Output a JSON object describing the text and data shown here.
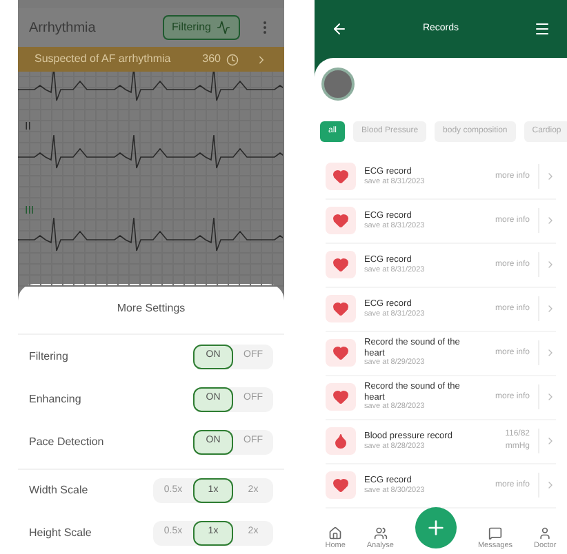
{
  "ecg_screen": {
    "title": "Arrhythmia",
    "filter_button": "Filtering",
    "alert": {
      "text": "Suspected of AF arrhythmia",
      "value": "360"
    },
    "leads": [
      "II",
      "III"
    ]
  },
  "settings_sheet": {
    "title": "More Settings",
    "rows": [
      {
        "label": "Filtering",
        "options": [
          {
            "label": "ON",
            "selected": true
          },
          {
            "label": "OFF",
            "selected": false
          }
        ]
      },
      {
        "label": "Enhancing",
        "options": [
          {
            "label": "ON",
            "selected": true
          },
          {
            "label": "OFF",
            "selected": false
          }
        ]
      },
      {
        "label": "Pace Detection",
        "options": [
          {
            "label": "ON",
            "selected": true
          },
          {
            "label": "OFF",
            "selected": false
          }
        ]
      },
      {
        "label": "Width Scale",
        "options": [
          {
            "label": "0.5x",
            "selected": false
          },
          {
            "label": "1x",
            "selected": true
          },
          {
            "label": "2x",
            "selected": false
          }
        ]
      },
      {
        "label": "Height Scale",
        "options": [
          {
            "label": "0.5x",
            "selected": false
          },
          {
            "label": "1x",
            "selected": true
          },
          {
            "label": "2x",
            "selected": false
          }
        ]
      }
    ]
  },
  "records_screen": {
    "title": "Records",
    "chips": [
      {
        "label": "all",
        "selected": true
      },
      {
        "label": "Blood Pressure",
        "selected": false
      },
      {
        "label": "body composition",
        "selected": false
      },
      {
        "label": "Cardiop",
        "selected": false
      }
    ],
    "records": [
      {
        "kind": "ecg",
        "title": "ECG record",
        "subtitle": "save at 8/31/2023",
        "detail": "more info"
      },
      {
        "kind": "ecg",
        "title": "ECG record",
        "subtitle": "save at 8/31/2023",
        "detail": "more info"
      },
      {
        "kind": "ecg",
        "title": "ECG record",
        "subtitle": "save at 8/31/2023",
        "detail": "more info"
      },
      {
        "kind": "ecg",
        "title": "ECG record",
        "subtitle": "save at 8/31/2023",
        "detail": "more info"
      },
      {
        "kind": "sound",
        "title": "Record the sound of the heart",
        "subtitle": "save at 8/29/2023",
        "detail": "more info"
      },
      {
        "kind": "sound",
        "title": "Record the sound of the heart",
        "subtitle": "save at 8/28/2023",
        "detail": "more info"
      },
      {
        "kind": "bp",
        "title": "Blood pressure record",
        "subtitle": "save at 8/28/2023",
        "detail": "116/82 mmHg"
      },
      {
        "kind": "ecg",
        "title": "ECG record",
        "subtitle": "save at 8/30/2023",
        "detail": "more info"
      }
    ],
    "nav": [
      {
        "kind": "home",
        "label": "Home"
      },
      {
        "kind": "analyze",
        "label": "Analyse"
      },
      {
        "kind": "add"
      },
      {
        "kind": "messages",
        "label": "Messages"
      },
      {
        "kind": "profile",
        "label": "Doctor"
      }
    ]
  }
}
